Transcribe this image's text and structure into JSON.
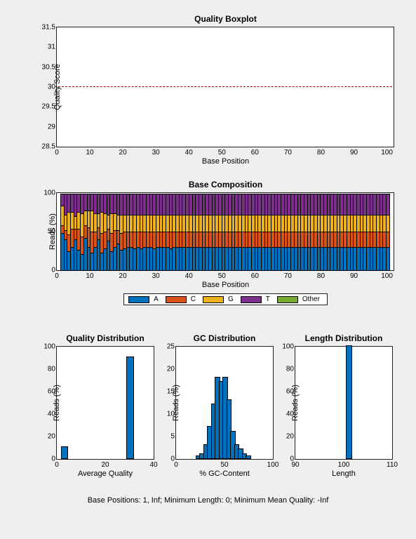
{
  "chart_data": [
    {
      "id": "quality_boxplot",
      "type": "line",
      "title": "Quality Boxplot",
      "xlabel": "Base Position",
      "ylabel": "Quality Score",
      "xlim": [
        0,
        102
      ],
      "ylim": [
        28.5,
        31.5
      ],
      "xticks": [
        0,
        10,
        20,
        30,
        40,
        50,
        60,
        70,
        80,
        90,
        100
      ],
      "yticks": [
        28.5,
        29,
        29.5,
        30,
        30.5,
        31,
        31.5
      ],
      "reference_line": 30
    },
    {
      "id": "base_composition",
      "type": "bar",
      "title": "Base Composition",
      "xlabel": "Base Position",
      "ylabel": "Reads (%)",
      "xlim": [
        0,
        102
      ],
      "ylim": [
        0,
        100
      ],
      "xticks": [
        0,
        10,
        20,
        30,
        40,
        50,
        60,
        70,
        80,
        90,
        100
      ],
      "yticks": [
        0,
        50,
        100
      ],
      "legend": [
        "A",
        "C",
        "G",
        "T",
        "Other"
      ],
      "series": [
        {
          "name": "A",
          "values": [
            48,
            40,
            24,
            30,
            40,
            26,
            20,
            42,
            30,
            22,
            30,
            40,
            22,
            28,
            38,
            24,
            30,
            34,
            26,
            28,
            30,
            30,
            28,
            30,
            28,
            30,
            30,
            30,
            28,
            30,
            30,
            30,
            30,
            28,
            30,
            30,
            30,
            30,
            30,
            30,
            30,
            30,
            30,
            30,
            30,
            30,
            30,
            30,
            30,
            30,
            30,
            30,
            30,
            30,
            30,
            30,
            30,
            30,
            30,
            30,
            30,
            30,
            30,
            30,
            30,
            30,
            30,
            30,
            30,
            30,
            30,
            30,
            30,
            30,
            30,
            30,
            30,
            30,
            30,
            30,
            30,
            30,
            30,
            30,
            30,
            30,
            30,
            30,
            30,
            30,
            30,
            30,
            30,
            30,
            30,
            30,
            30,
            30,
            30,
            30
          ]
        },
        {
          "name": "C",
          "values": [
            10,
            12,
            22,
            24,
            14,
            28,
            24,
            16,
            26,
            28,
            20,
            16,
            26,
            22,
            16,
            24,
            22,
            18,
            22,
            22,
            20,
            20,
            22,
            20,
            22,
            20,
            20,
            20,
            22,
            20,
            20,
            20,
            20,
            22,
            20,
            20,
            20,
            20,
            20,
            20,
            20,
            20,
            20,
            20,
            20,
            20,
            20,
            20,
            20,
            20,
            20,
            20,
            20,
            20,
            20,
            20,
            20,
            20,
            20,
            20,
            20,
            20,
            20,
            20,
            20,
            20,
            20,
            20,
            20,
            20,
            20,
            20,
            20,
            20,
            20,
            20,
            20,
            20,
            20,
            20,
            20,
            20,
            20,
            20,
            20,
            20,
            20,
            20,
            20,
            20,
            20,
            20,
            20,
            20,
            20,
            20,
            20,
            20,
            20,
            20
          ]
        },
        {
          "name": "G",
          "values": [
            26,
            20,
            30,
            22,
            16,
            22,
            30,
            20,
            22,
            28,
            24,
            18,
            28,
            24,
            18,
            26,
            22,
            20,
            24,
            22,
            22,
            22,
            22,
            22,
            22,
            22,
            22,
            22,
            22,
            22,
            22,
            22,
            22,
            22,
            22,
            22,
            22,
            22,
            22,
            22,
            22,
            22,
            22,
            22,
            22,
            22,
            22,
            22,
            22,
            22,
            22,
            22,
            22,
            22,
            22,
            22,
            22,
            22,
            22,
            22,
            22,
            22,
            22,
            22,
            22,
            22,
            22,
            22,
            22,
            22,
            22,
            22,
            22,
            22,
            22,
            22,
            22,
            22,
            22,
            22,
            22,
            22,
            22,
            22,
            22,
            22,
            22,
            22,
            22,
            22,
            22,
            22,
            22,
            22,
            22,
            22,
            22,
            22,
            22,
            22
          ]
        },
        {
          "name": "T",
          "values": [
            16,
            28,
            24,
            24,
            30,
            24,
            26,
            22,
            22,
            22,
            26,
            26,
            24,
            26,
            28,
            26,
            26,
            28,
            28,
            28,
            28,
            28,
            28,
            28,
            28,
            28,
            28,
            28,
            28,
            28,
            28,
            28,
            28,
            28,
            28,
            28,
            28,
            28,
            28,
            28,
            28,
            28,
            28,
            28,
            28,
            28,
            28,
            28,
            28,
            28,
            28,
            28,
            28,
            28,
            28,
            28,
            28,
            28,
            28,
            28,
            28,
            28,
            28,
            28,
            28,
            28,
            28,
            28,
            28,
            28,
            28,
            28,
            28,
            28,
            28,
            28,
            28,
            28,
            28,
            28,
            28,
            28,
            28,
            28,
            28,
            28,
            28,
            28,
            28,
            28,
            28,
            28,
            28,
            28,
            28,
            28,
            28,
            28,
            28,
            28
          ]
        }
      ]
    },
    {
      "id": "quality_distribution",
      "type": "bar",
      "title": "Quality Distribution",
      "xlabel": "Average Quality",
      "ylabel": "Reads (%)",
      "xlim": [
        0,
        40
      ],
      "ylim": [
        0,
        100
      ],
      "xticks": [
        0,
        20,
        40
      ],
      "yticks": [
        0,
        20,
        40,
        60,
        80,
        100
      ],
      "categories": [
        3,
        30
      ],
      "values": [
        10,
        90
      ]
    },
    {
      "id": "gc_distribution",
      "type": "bar",
      "title": "GC Distribution",
      "xlabel": "% GC-Content",
      "ylabel": "Reads (%)",
      "xlim": [
        0,
        100
      ],
      "ylim": [
        0,
        25
      ],
      "xticks": [
        0,
        50,
        100
      ],
      "yticks": [
        0,
        5,
        10,
        15,
        20,
        25
      ],
      "categories": [
        22,
        26,
        30,
        34,
        38,
        42,
        46,
        50,
        54,
        58,
        62,
        66,
        70,
        74
      ],
      "values": [
        0.5,
        1,
        3,
        7,
        12,
        18,
        17,
        18,
        13,
        6,
        3,
        2,
        1,
        0.5
      ]
    },
    {
      "id": "length_distribution",
      "type": "bar",
      "title": "Length Distribution",
      "xlabel": "Length",
      "ylabel": "Reads (%)",
      "xlim": [
        90,
        110
      ],
      "ylim": [
        0,
        100
      ],
      "xticks": [
        90,
        100,
        110
      ],
      "yticks": [
        0,
        20,
        40,
        60,
        80,
        100
      ],
      "categories": [
        101
      ],
      "values": [
        100
      ]
    }
  ],
  "footer_text": "Base Positions: 1, Inf;   Minimum Length: 0;   Minimum Mean Quality: -Inf",
  "legend_colors": {
    "A": "#0072bd",
    "C": "#d95319",
    "G": "#edb120",
    "T": "#7e2f8e",
    "Other": "#77ac30"
  }
}
